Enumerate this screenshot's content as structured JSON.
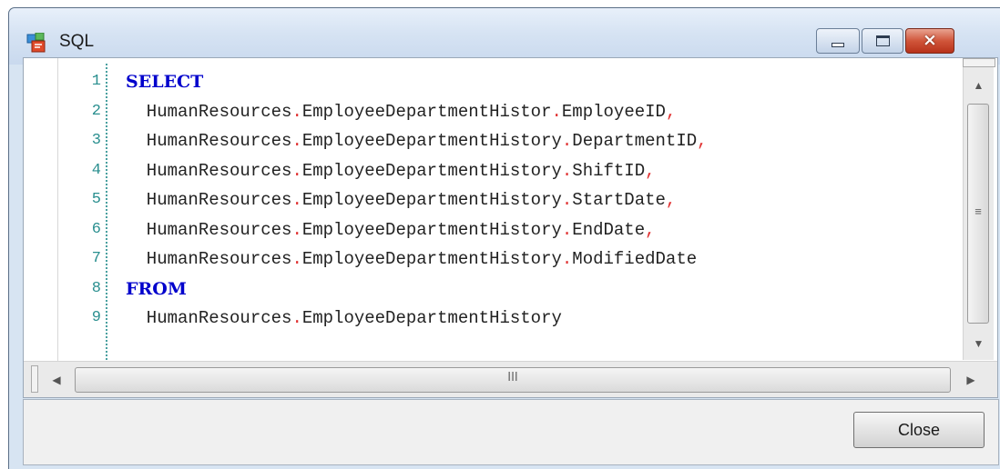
{
  "window": {
    "title": "SQL",
    "icon": "sql-query-icon",
    "controls": {
      "minimize": "minimize-icon",
      "maximize": "maximize-icon",
      "close": "×"
    }
  },
  "editor": {
    "line_numbers": [
      "1",
      "2",
      "3",
      "4",
      "5",
      "6",
      "7",
      "8",
      "9"
    ],
    "lines": [
      [
        {
          "t": "SELECT",
          "k": "kw"
        }
      ],
      [
        {
          "t": "  HumanResources"
        },
        {
          "t": ".",
          "k": "sep"
        },
        {
          "t": "EmployeeDepartmentHistor"
        },
        {
          "t": ".",
          "k": "sep"
        },
        {
          "t": "EmployeeID"
        },
        {
          "t": ",",
          "k": "sep"
        }
      ],
      [
        {
          "t": "  HumanResources"
        },
        {
          "t": ".",
          "k": "sep"
        },
        {
          "t": "EmployeeDepartmentHistory"
        },
        {
          "t": ".",
          "k": "sep"
        },
        {
          "t": "DepartmentID"
        },
        {
          "t": ",",
          "k": "sep"
        }
      ],
      [
        {
          "t": "  HumanResources"
        },
        {
          "t": ".",
          "k": "sep"
        },
        {
          "t": "EmployeeDepartmentHistory"
        },
        {
          "t": ".",
          "k": "sep"
        },
        {
          "t": "ShiftID"
        },
        {
          "t": ",",
          "k": "sep"
        }
      ],
      [
        {
          "t": "  HumanResources"
        },
        {
          "t": ".",
          "k": "sep"
        },
        {
          "t": "EmployeeDepartmentHistory"
        },
        {
          "t": ".",
          "k": "sep"
        },
        {
          "t": "StartDate"
        },
        {
          "t": ",",
          "k": "sep"
        }
      ],
      [
        {
          "t": "  HumanResources"
        },
        {
          "t": ".",
          "k": "sep"
        },
        {
          "t": "EmployeeDepartmentHistory"
        },
        {
          "t": ".",
          "k": "sep"
        },
        {
          "t": "EndDate"
        },
        {
          "t": ",",
          "k": "sep"
        }
      ],
      [
        {
          "t": "  HumanResources"
        },
        {
          "t": ".",
          "k": "sep"
        },
        {
          "t": "EmployeeDepartmentHistory"
        },
        {
          "t": ".",
          "k": "sep"
        },
        {
          "t": "ModifiedDate"
        }
      ],
      [
        {
          "t": "FROM",
          "k": "kw"
        }
      ],
      [
        {
          "t": "  HumanResources"
        },
        {
          "t": ".",
          "k": "sep"
        },
        {
          "t": "EmployeeDepartmentHistory"
        }
      ]
    ]
  },
  "scrollbars": {
    "vertical": {
      "up": "▲",
      "down": "▼",
      "grip": "≡"
    },
    "horizontal": {
      "left": "◀",
      "right": "▶",
      "grip": "III"
    }
  },
  "footer": {
    "close_label": "Close"
  },
  "colors": {
    "keyword": "#0000cc",
    "separator": "#e03030",
    "line_number": "#2a8f8f"
  }
}
